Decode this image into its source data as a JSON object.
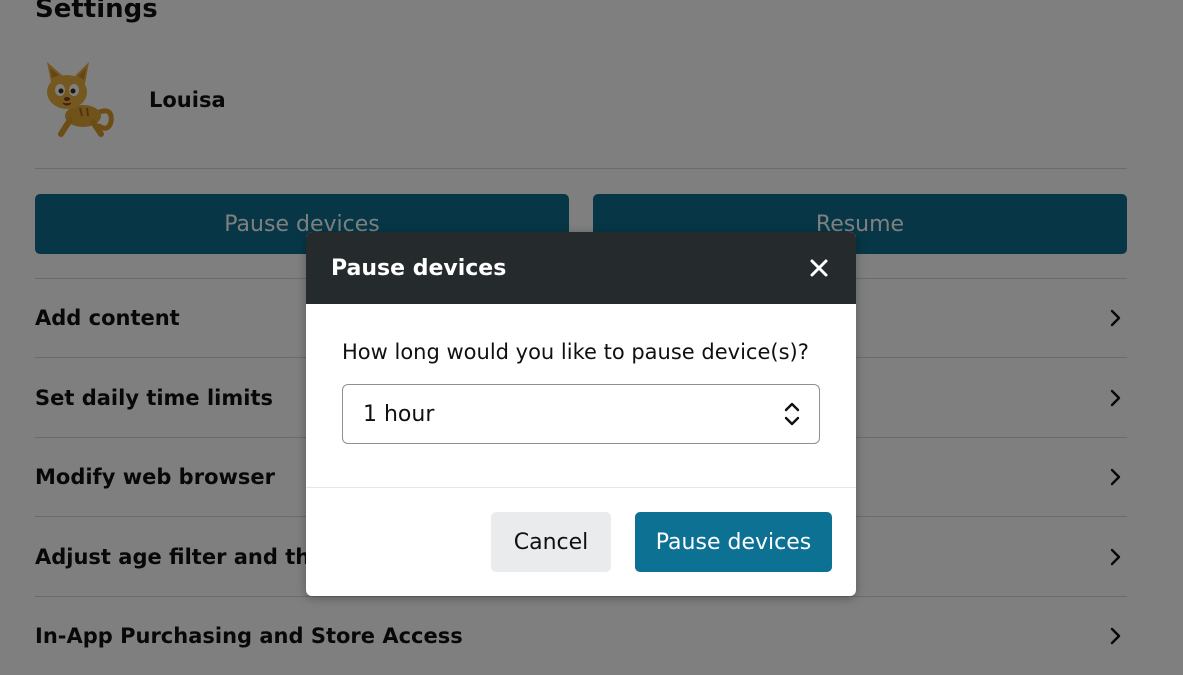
{
  "page": {
    "title": "Settings",
    "profile": {
      "name": "Louisa",
      "avatar_icon": "cartoon-cat-avatar"
    },
    "actions": {
      "pause_label": "Pause devices",
      "resume_label": "Resume"
    },
    "rows": [
      {
        "label": "Add content"
      },
      {
        "label": "Set daily time limits"
      },
      {
        "label": "Modify web browser"
      },
      {
        "label": "Adjust age filter and the"
      },
      {
        "label": "In-App Purchasing and Store Access"
      }
    ]
  },
  "dialog": {
    "title": "Pause devices",
    "question": "How long would you like to pause device(s)?",
    "duration_select": {
      "value": "1 hour"
    },
    "cancel_label": "Cancel",
    "confirm_label": "Pause devices"
  },
  "colors": {
    "primary_button": "#0d7194",
    "dialog_header": "#252a2d",
    "overlay": "rgba(0,0,0,0.5)"
  }
}
